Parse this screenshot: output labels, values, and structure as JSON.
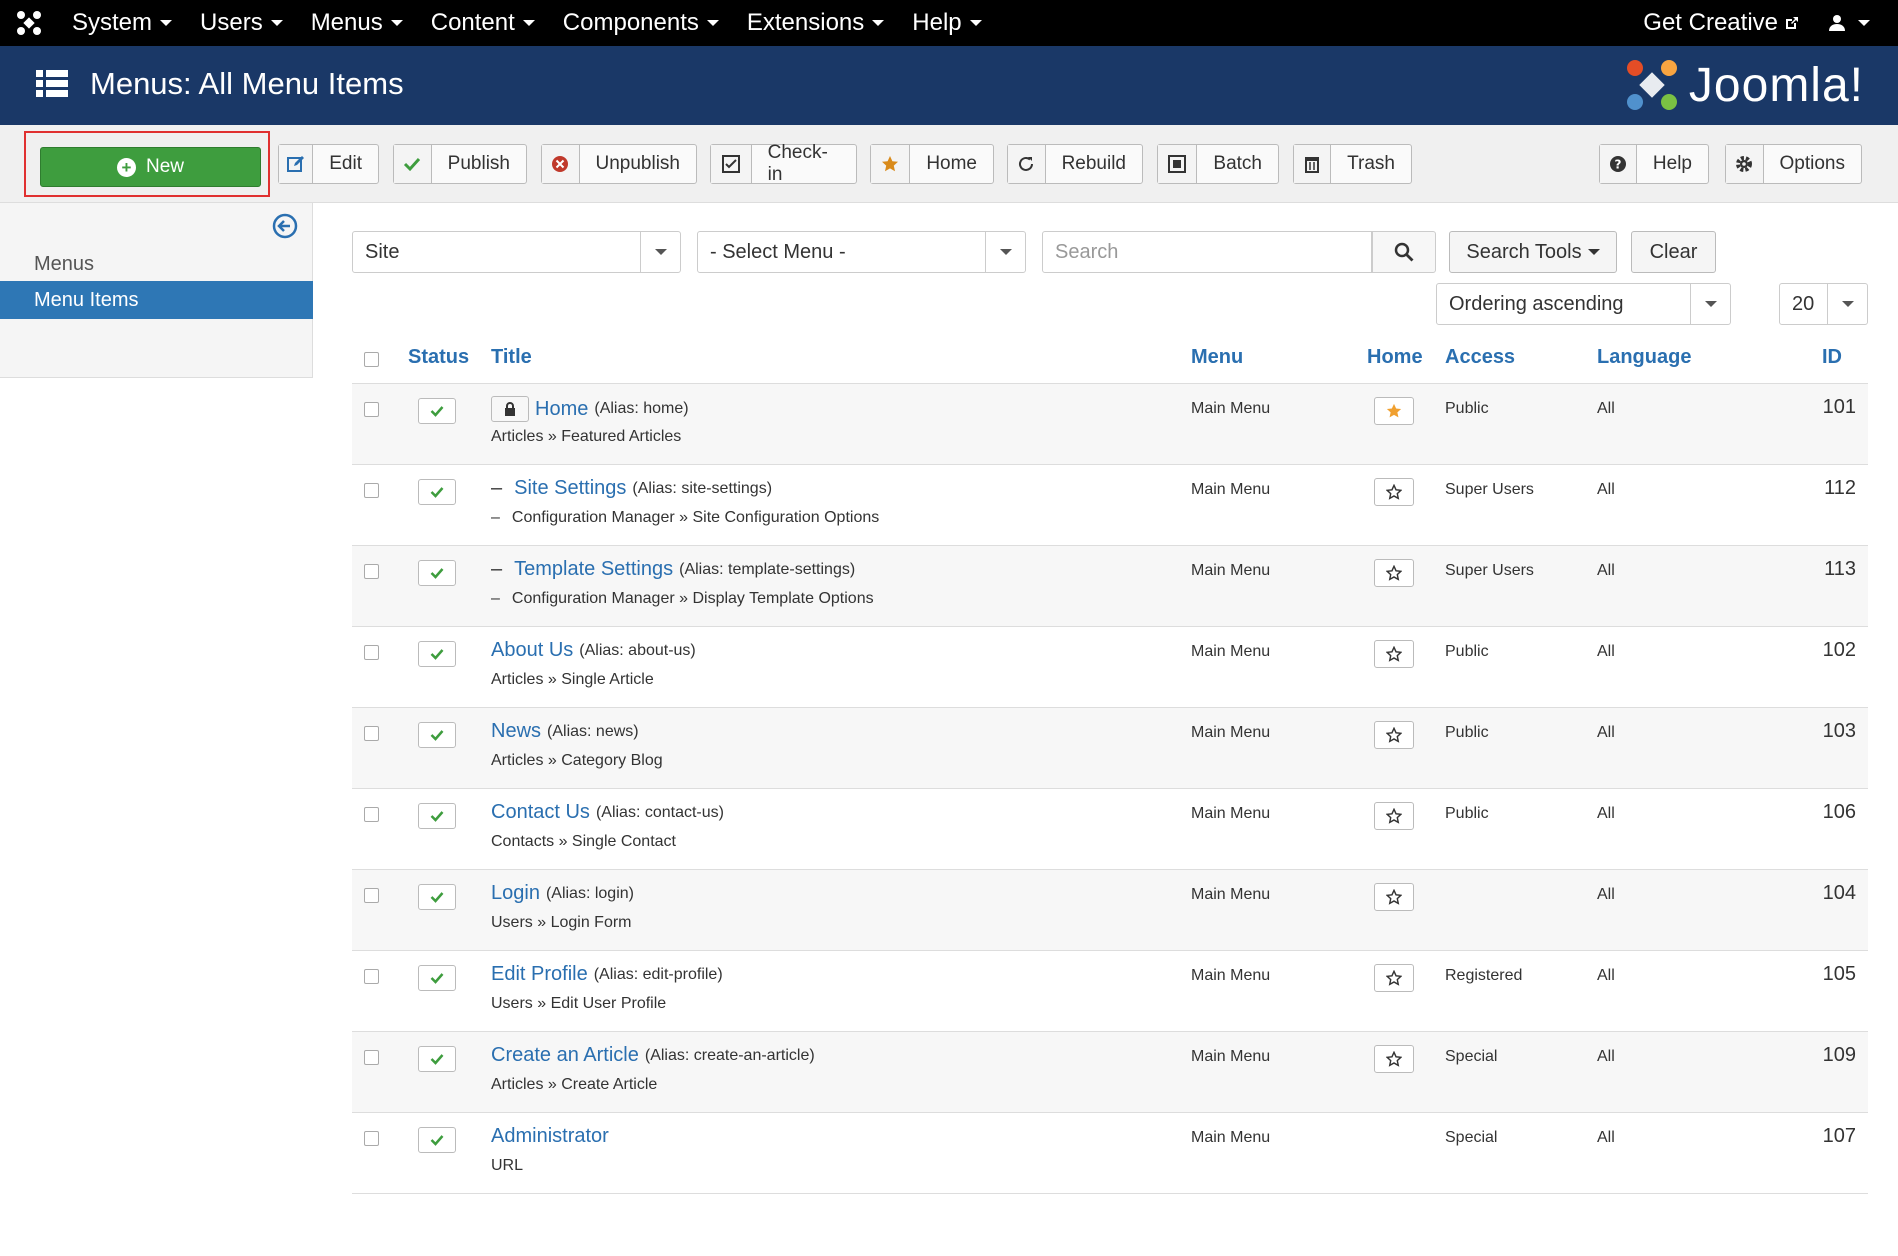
{
  "topnav": {
    "items": [
      "System",
      "Users",
      "Menus",
      "Content",
      "Components",
      "Extensions",
      "Help"
    ],
    "get_creative": "Get Creative"
  },
  "header": {
    "title": "Menus: All Menu Items",
    "brand": "Joomla!"
  },
  "toolbar": {
    "new": "New",
    "edit": "Edit",
    "publish": "Publish",
    "unpublish": "Unpublish",
    "checkin": "Check-in",
    "home": "Home",
    "rebuild": "Rebuild",
    "batch": "Batch",
    "trash": "Trash",
    "help": "Help",
    "options": "Options"
  },
  "sidebar": {
    "menus": "Menus",
    "menu_items": "Menu Items"
  },
  "filters": {
    "client": "Site",
    "menu": "- Select Menu -",
    "search_placeholder": "Search",
    "search_tools": "Search Tools",
    "clear": "Clear",
    "ordering": "Ordering ascending",
    "limit": "20"
  },
  "table": {
    "headers": {
      "status": "Status",
      "title": "Title",
      "menu": "Menu",
      "home": "Home",
      "access": "Access",
      "language": "Language",
      "id": "ID"
    },
    "rows": [
      {
        "title": "Home",
        "alias": "(Alias: home)",
        "sub": "Articles » Featured Articles",
        "menu": "Main Menu",
        "access": "Public",
        "language": "All",
        "id": "101"
      },
      {
        "title": "Site Settings",
        "alias": "(Alias: site-settings)",
        "sub": "Configuration Manager » Site Configuration Options",
        "menu": "Main Menu",
        "access": "Super Users",
        "language": "All",
        "id": "112"
      },
      {
        "title": "Template Settings",
        "alias": "(Alias: template-settings)",
        "sub": "Configuration Manager » Display Template Options",
        "menu": "Main Menu",
        "access": "Super Users",
        "language": "All",
        "id": "113"
      },
      {
        "title": "About Us",
        "alias": "(Alias: about-us)",
        "sub": "Articles » Single Article",
        "menu": "Main Menu",
        "access": "Public",
        "language": "All",
        "id": "102"
      },
      {
        "title": "News",
        "alias": "(Alias: news)",
        "sub": "Articles » Category Blog",
        "menu": "Main Menu",
        "access": "Public",
        "language": "All",
        "id": "103"
      },
      {
        "title": "Contact Us",
        "alias": "(Alias: contact-us)",
        "sub": "Contacts » Single Contact",
        "menu": "Main Menu",
        "access": "Public",
        "language": "All",
        "id": "106"
      },
      {
        "title": "Login",
        "alias": "(Alias: login)",
        "sub": "Users » Login Form",
        "menu": "Main Menu",
        "access": "",
        "language": "All",
        "id": "104"
      },
      {
        "title": "Edit Profile",
        "alias": "(Alias: edit-profile)",
        "sub": "Users » Edit User Profile",
        "menu": "Main Menu",
        "access": "Registered",
        "language": "All",
        "id": "105"
      },
      {
        "title": "Create an Article",
        "alias": "(Alias: create-an-article)",
        "sub": "Articles » Create Article",
        "menu": "Main Menu",
        "access": "Special",
        "language": "All",
        "id": "109"
      },
      {
        "title": "Administrator",
        "alias": "",
        "sub": "URL",
        "menu": "Main Menu",
        "access": "Special",
        "language": "All",
        "id": "107"
      }
    ]
  },
  "colors": {
    "header_bg": "#1a3867",
    "accent_blue": "#2a6fb0",
    "new_green": "#3e9d3e",
    "highlight_red": "#e03030"
  }
}
